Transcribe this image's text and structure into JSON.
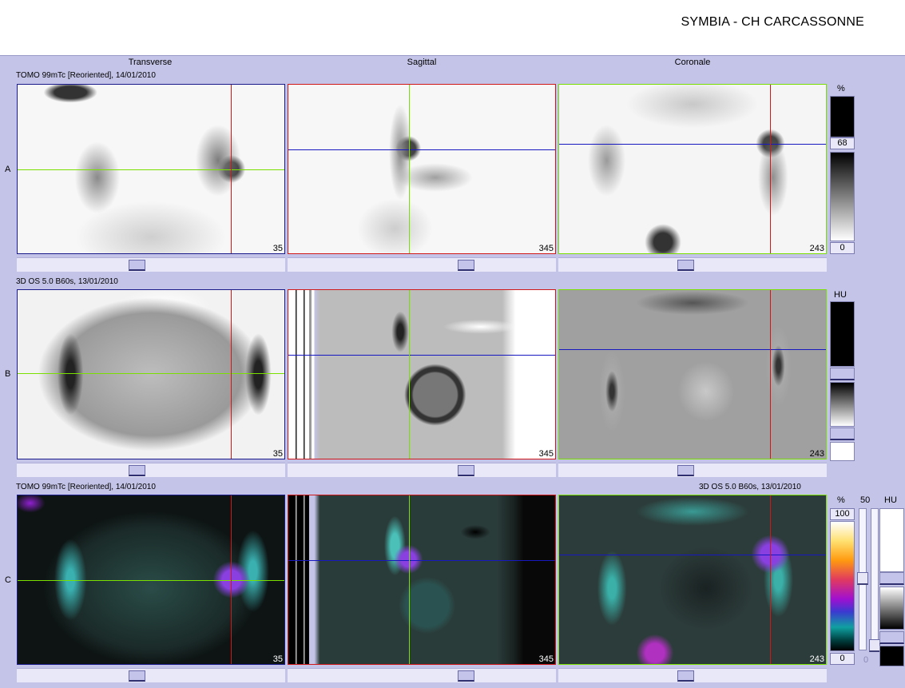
{
  "header": {
    "site_title": "SYMBIA - CH CARCASSONNE"
  },
  "columns": [
    "Transverse",
    "Sagittal",
    "Coronale"
  ],
  "rows": [
    {
      "letter": "A",
      "series_label": "TOMO 99mTc [Reoriented], 14/01/2010",
      "unit": "%",
      "top_value": "68",
      "bottom_value": "0"
    },
    {
      "letter": "B",
      "series_label": "3D  OS  5.0  B60s, 13/01/2010",
      "unit": "HU"
    },
    {
      "letter": "C",
      "series_label": "TOMO 99mTc [Reoriented], 14/01/2010",
      "series_label_right": "3D  OS  5.0  B60s, 13/01/2010",
      "unit_left": "%",
      "top_value": "100",
      "bottom_value": "0",
      "blend_value": "50",
      "blend_bottom": "0",
      "unit_right": "HU"
    }
  ],
  "slice_numbers": [
    "35",
    "345",
    "243"
  ],
  "colors": {
    "background": "#c4c4e8",
    "crosshair_transverse_vertical": "#d01818",
    "crosshair_transverse_horizontal": "#7ae000",
    "crosshair_sagittal_vertical": "#7ae000",
    "crosshair_sagittal_horizontal": "#1818c0",
    "crosshair_coronal_vertical": "#d01818",
    "crosshair_coronal_horizontal": "#1818c0",
    "frame_transverse": "#1a1a8a",
    "frame_sagittal": "#d01818",
    "frame_coronal": "#7ae000"
  }
}
